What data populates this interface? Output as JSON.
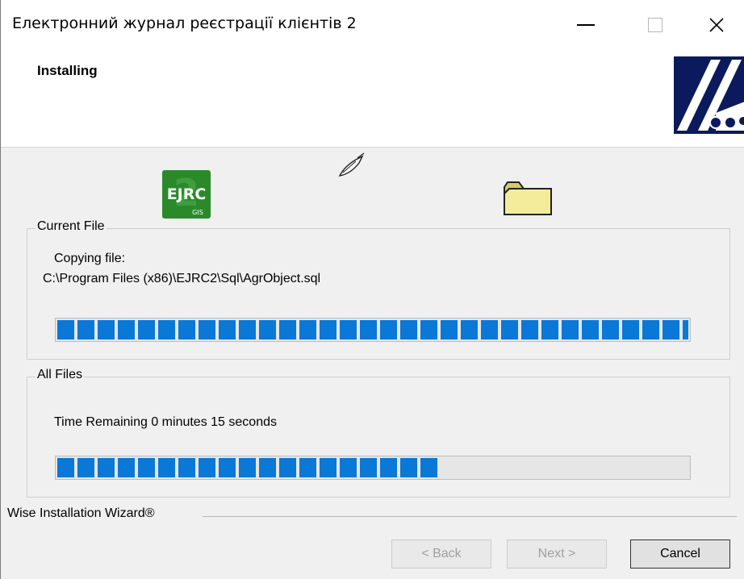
{
  "window": {
    "title": "Електронний журнал реєстрації клієнтів 2"
  },
  "header": {
    "title": "Installing"
  },
  "icons": {
    "app_icon": {
      "name": "ejrc-app-icon",
      "text": "EJRC",
      "subtext": "GIS",
      "color": "#2a8a2a"
    },
    "pen": "pen-icon",
    "folder": "folder-icon"
  },
  "current_file": {
    "legend": "Current File",
    "label": "Copying file:",
    "path": "C:\\Program Files (x86)\\EJRC2\\Sql\\AgrObject.sql",
    "progress": 1.0
  },
  "all_files": {
    "legend": "All Files",
    "status": "Time Remaining 0 minutes 15 seconds",
    "progress": 0.62
  },
  "footer": {
    "wizard_label": "Wise Installation Wizard®"
  },
  "buttons": {
    "back": "< Back",
    "next": "Next >",
    "cancel": "Cancel"
  },
  "colors": {
    "progress": "#0a78d7",
    "logo_bg": "#0a1a5c"
  }
}
